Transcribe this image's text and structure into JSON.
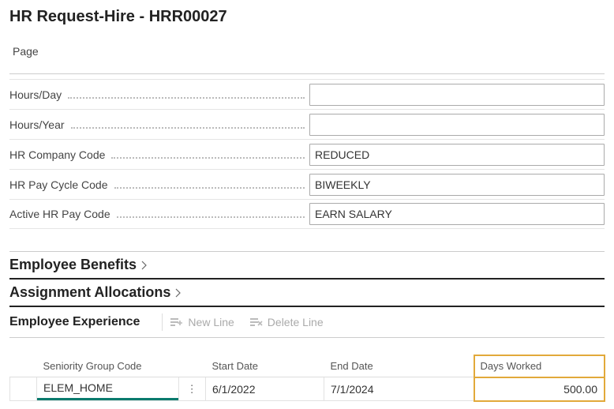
{
  "pageTitle": "HR Request-Hire - HRR00027",
  "pageLabel": "Page",
  "fields": {
    "hoursDay": {
      "label": "Hours/Day",
      "value": ""
    },
    "hoursYear": {
      "label": "Hours/Year",
      "value": ""
    },
    "company": {
      "label": "HR Company Code",
      "value": "REDUCED"
    },
    "payCycle": {
      "label": "HR Pay Cycle Code",
      "value": "BIWEEKLY"
    },
    "payCode": {
      "label": "Active HR Pay Code",
      "value": "EARN SALARY"
    }
  },
  "sections": {
    "benefits": "Employee Benefits",
    "allocations": "Assignment Allocations",
    "experience": "Employee Experience"
  },
  "toolbar": {
    "newLine": "New Line",
    "deleteLine": "Delete Line"
  },
  "table": {
    "headers": {
      "seniority": "Seniority Group Code",
      "start": "Start Date",
      "end": "End Date",
      "days": "Days Worked"
    },
    "rows": [
      {
        "seniority": "ELEM_HOME",
        "start": "6/1/2022",
        "end": "7/1/2024",
        "days": "500.00"
      }
    ]
  }
}
